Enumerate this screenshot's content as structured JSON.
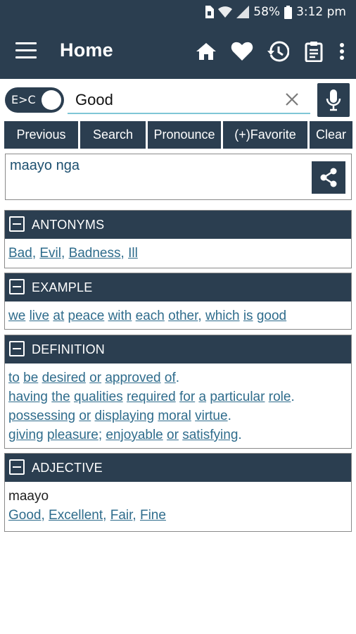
{
  "status": {
    "battery": "58%",
    "time": "3:12 pm",
    "icons": [
      "sim-icon",
      "wifi-icon",
      "signal-icon",
      "battery-icon"
    ]
  },
  "appbar": {
    "title": "Home",
    "actions": [
      "home-icon",
      "favorite-heart-icon",
      "history-icon",
      "clipboard-icon",
      "more-vert-icon"
    ]
  },
  "search": {
    "toggle_label": "E>C",
    "query": "Good",
    "placeholder": ""
  },
  "actions": {
    "previous": "Previous",
    "search": "Search",
    "pronounce": "Pronounce",
    "favorite": "(+)Favorite",
    "clear": "Clear"
  },
  "result": {
    "translation": "maayo nga"
  },
  "sections": {
    "antonyms": {
      "title": "ANTONYMS",
      "words": [
        "Bad",
        "Evil",
        "Badness",
        "Ill"
      ]
    },
    "example": {
      "title": "EXAMPLE",
      "words": [
        "we",
        "live",
        "at",
        "peace",
        "with",
        "each",
        "other",
        "which",
        "is",
        "good"
      ]
    },
    "definition": {
      "title": "DEFINITION",
      "line1": [
        "to",
        "be",
        "desired",
        "or",
        "approved",
        "of"
      ],
      "line2": [
        "having",
        "the",
        "qualities",
        "required",
        "for",
        "a",
        "particular",
        "role"
      ],
      "line3": [
        "possessing",
        "or",
        "displaying",
        "moral",
        "virtue"
      ],
      "line4": [
        "giving",
        "pleasure",
        "enjoyable",
        "or",
        "satisfying"
      ]
    },
    "adjective": {
      "title": "ADJECTIVE",
      "translation": "maayo",
      "words": [
        "Good",
        "Excellent",
        "Fair",
        "Fine"
      ]
    }
  },
  "colors": {
    "primary": "#2b3e50",
    "link": "#2f6c8c",
    "accent_line": "#7fc6d6"
  }
}
